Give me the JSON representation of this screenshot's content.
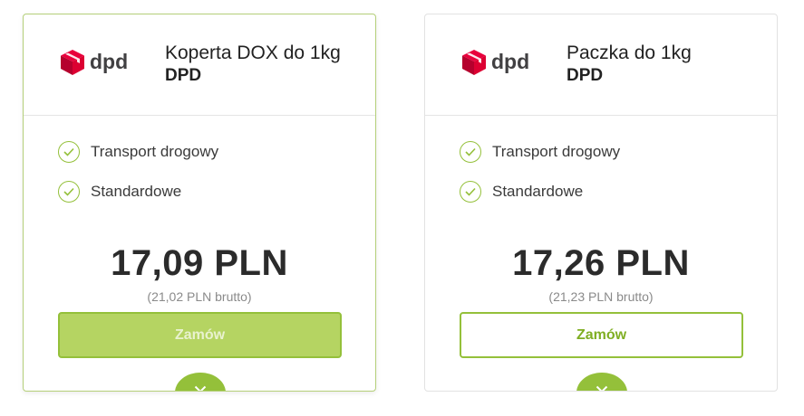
{
  "cards": [
    {
      "logo_text": "dpd",
      "title": "Koperta DOX do 1kg",
      "carrier": "DPD",
      "features": [
        "Transport drogowy",
        "Standardowe"
      ],
      "price": "17,09 PLN",
      "price_brutto": "(21,02 PLN brutto)",
      "order_label": "Zamów",
      "selected": true
    },
    {
      "logo_text": "dpd",
      "title": "Paczka do 1kg",
      "carrier": "DPD",
      "features": [
        "Transport drogowy",
        "Standardowe"
      ],
      "price": "17,26 PLN",
      "price_brutto": "(21,23 PLN brutto)",
      "order_label": "Zamów",
      "selected": false
    }
  ],
  "icons": {
    "logo": "dpd-cube-logo-icon",
    "feature": "check-circle-icon",
    "expand": "chevron-down-icon"
  },
  "colors": {
    "accent": "#94c03a",
    "accent_fill": "#b5d462",
    "logo_red": "#dc0032",
    "text": "#2b2b2b"
  }
}
